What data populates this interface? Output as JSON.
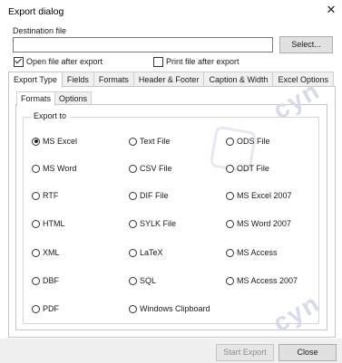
{
  "dialog": {
    "title": "Export dialog",
    "close_glyph": "✕"
  },
  "destination": {
    "label": "Destination file",
    "value": "",
    "select_button": "Select..."
  },
  "options": {
    "open_after": {
      "label": "Open file after export",
      "checked": true
    },
    "print_after": {
      "label": "Print file after export",
      "checked": false
    }
  },
  "tabs": [
    "Export Type",
    "Fields",
    "Formats",
    "Header & Footer",
    "Caption & Width",
    "Excel Options"
  ],
  "subtabs": [
    "Formats",
    "Options"
  ],
  "export_to": {
    "label": "Export to",
    "col1": [
      "MS Excel",
      "MS Word",
      "RTF",
      "HTML",
      "XML",
      "DBF",
      "PDF"
    ],
    "col2": [
      "Text File",
      "CSV File",
      "DIF File",
      "SYLK File",
      "LaTeX",
      "SQL",
      "Windows Clipboard"
    ],
    "col3": [
      "ODS File",
      "ODT File",
      "MS Excel 2007",
      "MS Word 2007",
      "MS Access",
      "MS Access 2007"
    ],
    "selected": "MS Excel"
  },
  "buttons": {
    "start": "Start Export",
    "close": "Close"
  },
  "watermark": "cyn"
}
